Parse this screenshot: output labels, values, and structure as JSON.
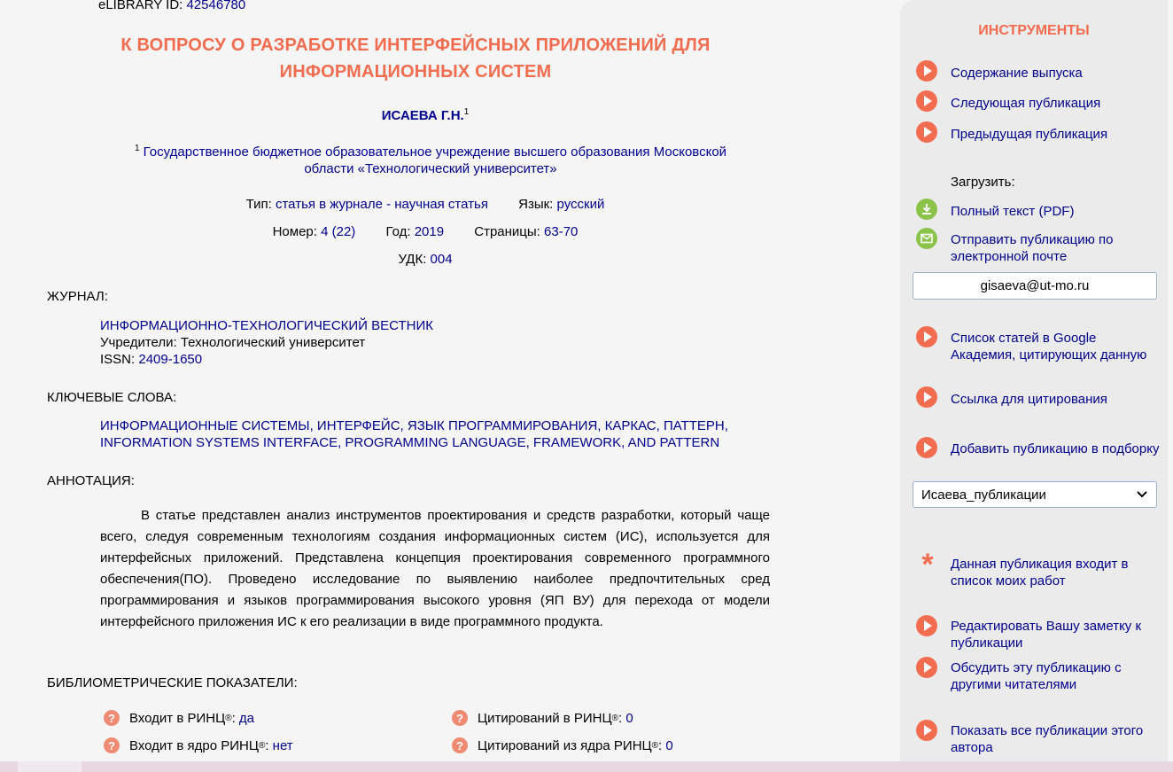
{
  "article": {
    "elibrary_id_label": "eLIBRARY ID:",
    "elibrary_id": "42546780",
    "title": "К ВОПРОСУ О РАЗРАБОТКЕ ИНТЕРФЕЙСНЫХ ПРИЛОЖЕНИЙ ДЛЯ ИНФОРМАЦИОННЫХ СИСТЕМ",
    "author": "ИСАЕВА Г.Н.",
    "author_sup": "1",
    "affiliation_sup": "1",
    "affiliation": "Государственное бюджетное образовательное учреждение высшего образования Московской области «Технологический университет»",
    "type_label": "Тип:",
    "type": "статья в журнале - научная статья",
    "lang_label": "Язык:",
    "lang": "русский",
    "number_label": "Номер:",
    "number": "4 (22)",
    "year_label": "Год:",
    "year": "2019",
    "pages_label": "Страницы:",
    "pages": "63-70",
    "udk_label": "УДК:",
    "udk": "004"
  },
  "journal": {
    "label": "ЖУРНАЛ:",
    "name": "ИНФОРМАЦИОННО-ТЕХНОЛОГИЧЕСКИЙ ВЕСТНИК",
    "founders": "Учредители: Технологический университет",
    "issn_label": "ISSN:",
    "issn": "2409-1650"
  },
  "keywords": {
    "label": "КЛЮЧЕВЫЕ СЛОВА:",
    "line1": "ИНФОРМАЦИОННЫЕ СИСТЕМЫ, ИНТЕРФЕЙС, ЯЗЫК ПРОГРАММИРОВАНИЯ, КАРКАС, ПАТТЕРН,",
    "line2": "INFORMATION SYSTEMS INTERFACE, PROGRAMMING LANGUAGE, FRAMEWORK, AND PATTERN"
  },
  "annotation": {
    "label": "АННОТАЦИЯ:",
    "text": "В статье представлен анализ инструментов проектирования и средств разработки, который чаще всего, следуя современным технологиям создания информационных систем (ИС), используется для интерфейсных приложений. Представлена концепция проектирования современного программного обеспечения(ПО). Проведено исследование по выявлению наиболее предпочтительных сред программирования и языков программирования высокого уровня (ЯП ВУ) для перехода от модели интерфейсного приложения ИС к его реализации в виде программного продукта."
  },
  "bibliometrics": {
    "label": "БИБЛИОМЕТРИЧЕСКИЕ ПОКАЗАТЕЛИ:",
    "rinc_label": "Входит в РИНЦ",
    "rinc_value": "да",
    "core_label": "Входит в ядро РИНЦ",
    "core_value": "нет",
    "cit_label": "Цитирований в РИНЦ",
    "cit_value": "0",
    "cit_core_label": "Цитирований из ядра РИНЦ",
    "cit_core_value": "0",
    "reg": "®"
  },
  "sidebar": {
    "title": "ИНСТРУМЕНТЫ",
    "issue_contents": "Содержание выпуска",
    "next_pub": "Следующая публикация",
    "prev_pub": "Предыдущая публикация",
    "download_label": "Загрузить:",
    "full_text": "Полный текст (PDF)",
    "send_email": "Отправить публикацию по электронной почте",
    "email_value": "gisaeva@ut-mo.ru",
    "google_scholar": "Список статей в Google Академия, цитирующих данную",
    "cite_link": "Ссылка для цитирования",
    "add_to_collection": "Добавить публикацию в подборку",
    "collection_selected": "Исаева_публикации",
    "in_my_works": "Данная публикация входит в список моих работ",
    "edit_note": "Редактировать Вашу заметку к публикации",
    "discuss": "Обсудить эту публикацию с другими читателями",
    "show_all": "Показать все публикации этого автора"
  }
}
